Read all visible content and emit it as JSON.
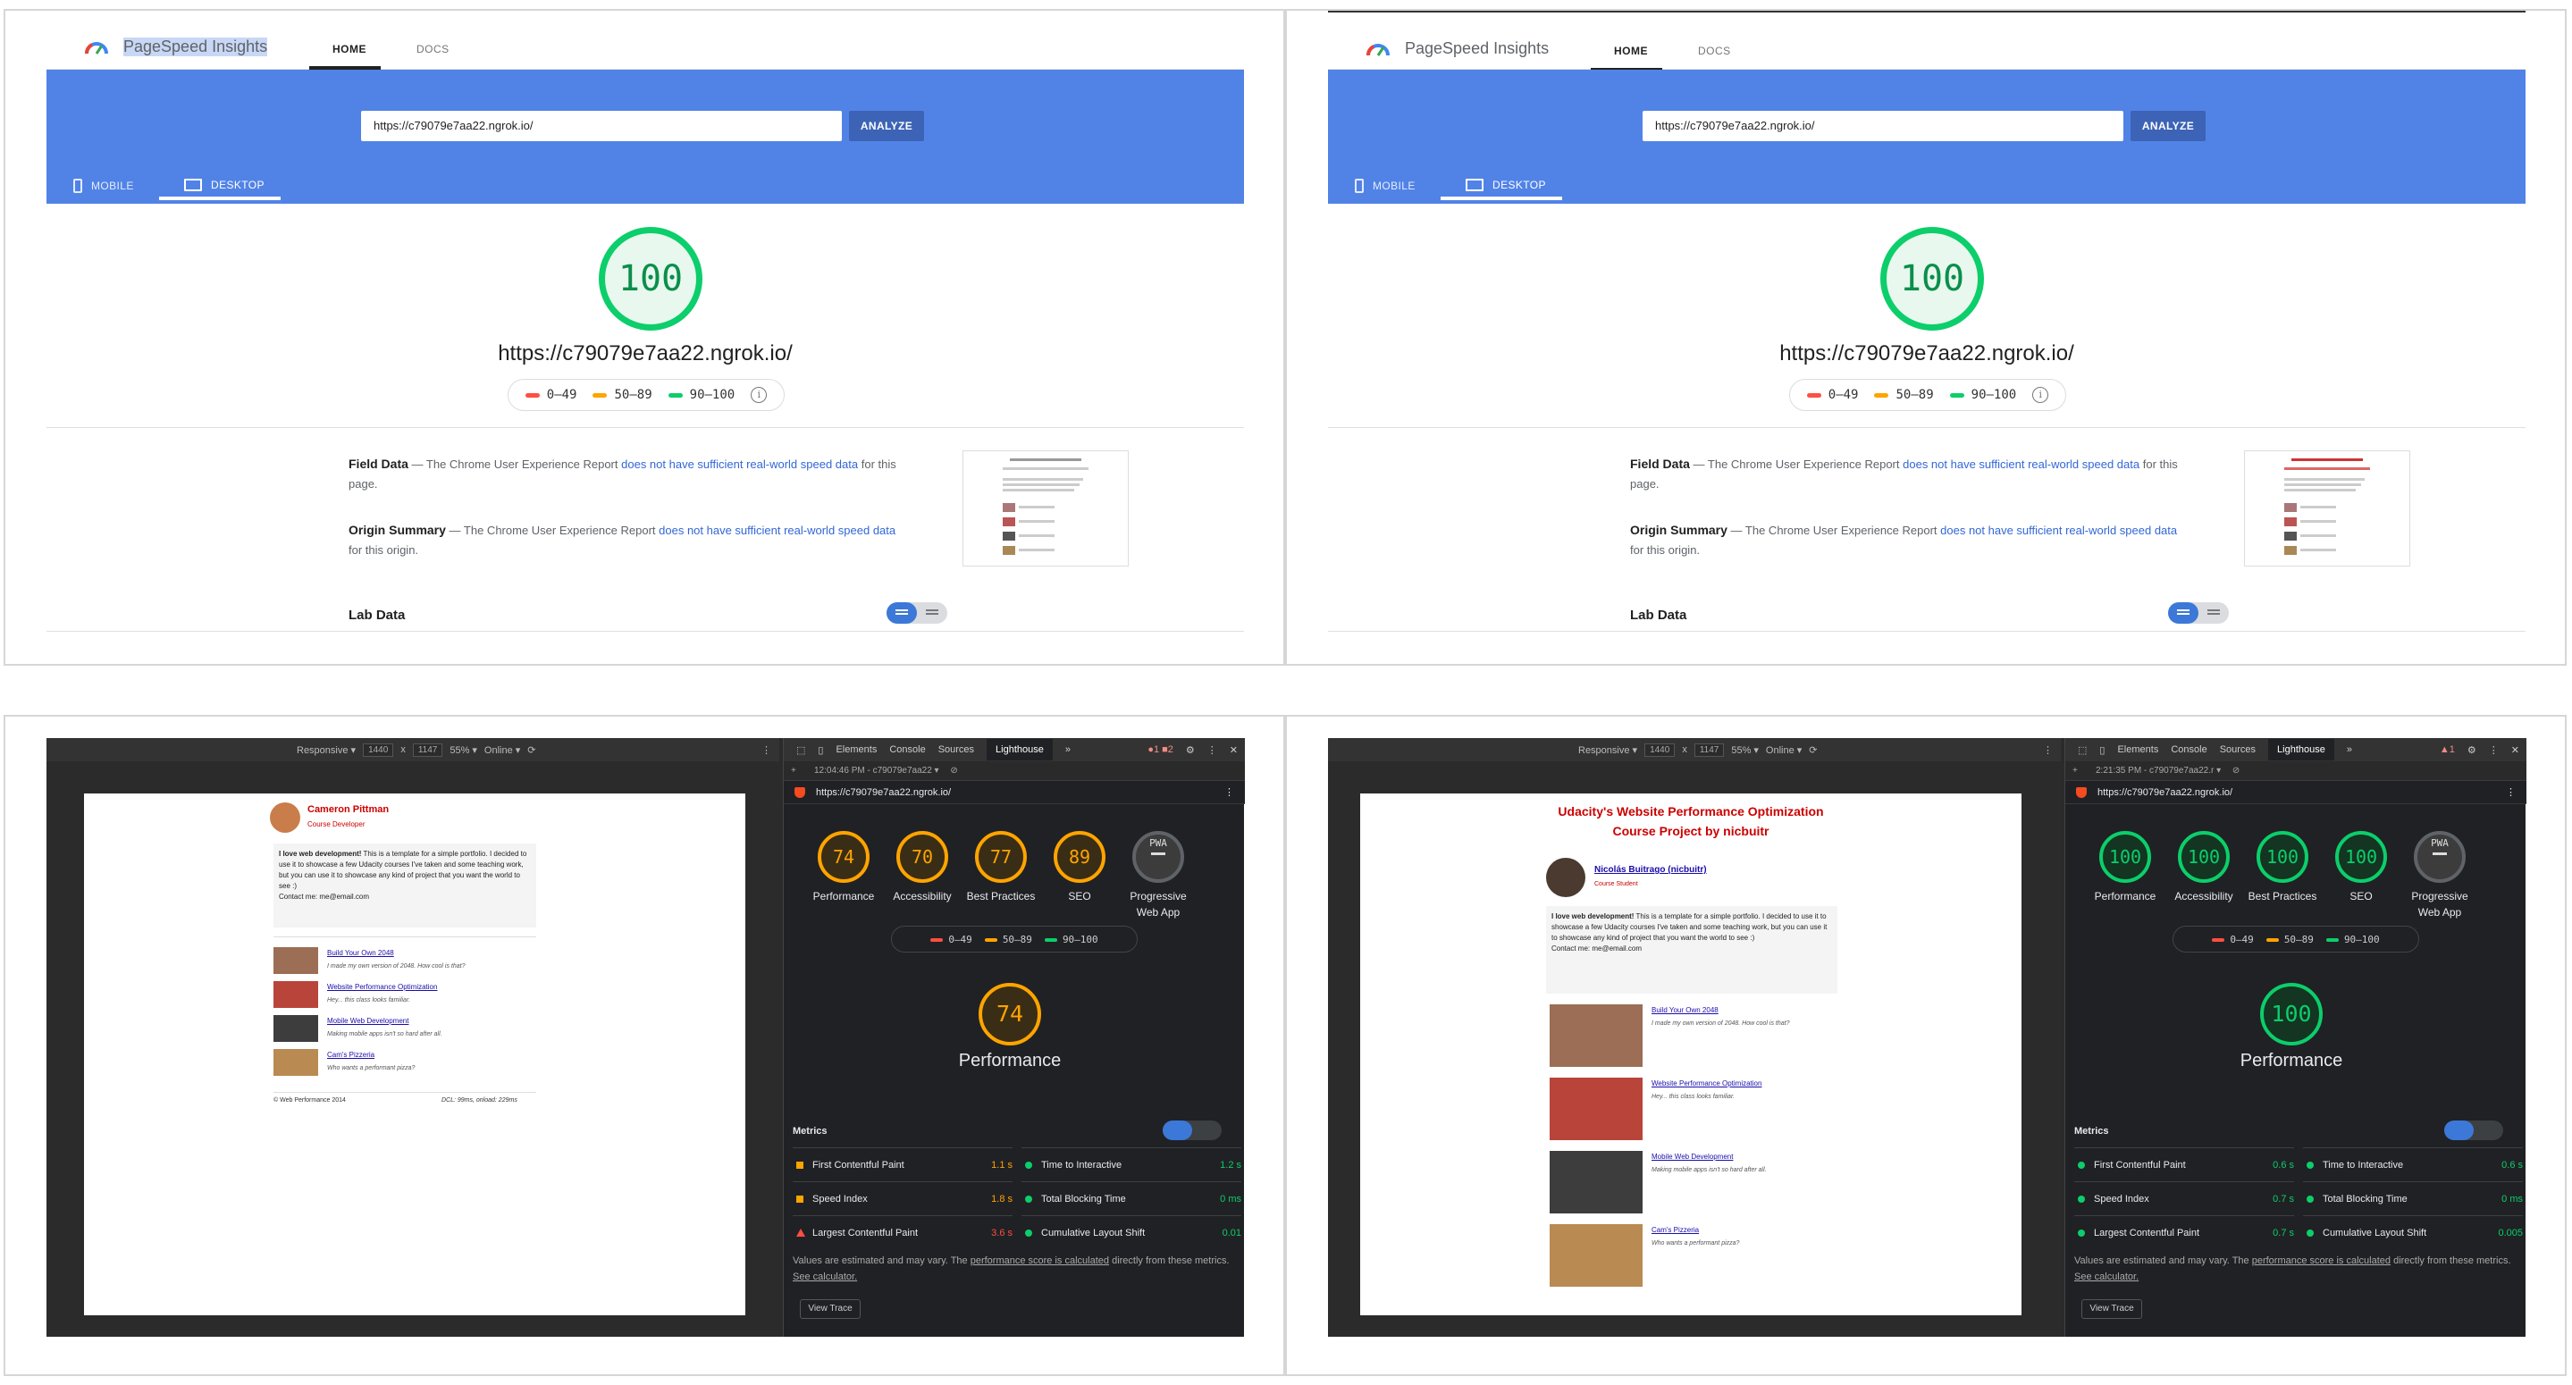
{
  "psi": {
    "app_name": "PageSpeed Insights",
    "tab_home": "HOME",
    "tab_docs": "DOCS",
    "url_input": "https://c79079e7aa22.ngrok.io/",
    "analyze_label": "ANALYZE",
    "mobile_label": "MOBILE",
    "desktop_label": "DESKTOP",
    "score": "100",
    "tested_url": "https://c79079e7aa22.ngrok.io/",
    "legend": [
      "0–49",
      "50–89",
      "90–100"
    ],
    "field_title": "Field Data",
    "field_pre": "— The Chrome User Experience Report",
    "field_link": "does not have sufficient real-world speed data",
    "field_post": "for this page.",
    "origin_title": "Origin Summary",
    "origin_pre": "— The Chrome User Experience Report",
    "origin_link": "does not have sufficient real-world speed data",
    "origin_post": "for this origin.",
    "lab_title": "Lab Data"
  },
  "colors": {
    "pass": "#0cce6b",
    "average": "#ffa400",
    "fail": "#ff4e42",
    "psi_blue": "#5183e7"
  },
  "devtools": {
    "responsive": "Responsive ▾",
    "width": "1440",
    "x": "x",
    "height": "1147",
    "zoom": "55% ▾",
    "online": "Online ▾",
    "tabs": [
      "Elements",
      "Console",
      "Sources",
      "Lighthouse",
      "»"
    ],
    "left": {
      "timestamp": "12:04:46 PM - c79079e7aa22 ▾",
      "badges": "●1  ■2",
      "url": "https://c79079e7aa22.ngrok.io/",
      "categories": [
        {
          "score": "74",
          "label": "Performance"
        },
        {
          "score": "70",
          "label": "Accessibility"
        },
        {
          "score": "77",
          "label": "Best Practices"
        },
        {
          "score": "89",
          "label": "SEO"
        },
        {
          "score": "PWA",
          "label": "Progressive Web App"
        }
      ],
      "perf_score": "74",
      "perf_label": "Performance",
      "metrics_title": "Metrics",
      "metrics": [
        {
          "label": "First Contentful Paint",
          "value": "1.1 s"
        },
        {
          "label": "Speed Index",
          "value": "1.8 s"
        },
        {
          "label": "Largest Contentful Paint",
          "value": "3.6 s"
        },
        {
          "label": "Time to Interactive",
          "value": "1.2 s"
        },
        {
          "label": "Total Blocking Time",
          "value": "0 ms"
        },
        {
          "label": "Cumulative Layout Shift",
          "value": "0.01"
        }
      ],
      "page": {
        "name": "Cameron Pittman",
        "role": "Course Developer",
        "intro_bold": "I love web development!",
        "intro": " This is a template for a simple portfolio. I decided to use it to showcase a few Udacity courses I've taken and some teaching work, but you can use it to showcase any kind of project that you want the world to see :)",
        "contact": "Contact me: me@email.com",
        "items": [
          {
            "title": "Build Your Own 2048",
            "desc": "I made my own version of 2048. How cool is that?"
          },
          {
            "title": "Website Performance Optimization",
            "desc": "Hey... this class looks familiar."
          },
          {
            "title": "Mobile Web Development",
            "desc": "Making mobile apps isn't so hard after all."
          },
          {
            "title": "Cam's Pizzeria",
            "desc": "Who wants a performant pizza?"
          }
        ],
        "footer_left": "© Web Performance 2014",
        "footer_right": "DCL: 99ms, onload: 229ms"
      }
    },
    "right": {
      "timestamp": "2:21:35 PM - c79079e7aa22.r ▾",
      "badges": "▲1",
      "url": "https://c79079e7aa22.ngrok.io/",
      "categories": [
        {
          "score": "100",
          "label": "Performance"
        },
        {
          "score": "100",
          "label": "Accessibility"
        },
        {
          "score": "100",
          "label": "Best Practices"
        },
        {
          "score": "100",
          "label": "SEO"
        },
        {
          "score": "PWA",
          "label": "Progressive Web App"
        }
      ],
      "perf_score": "100",
      "perf_label": "Performance",
      "metrics_title": "Metrics",
      "metrics": [
        {
          "label": "First Contentful Paint",
          "value": "0.6 s"
        },
        {
          "label": "Speed Index",
          "value": "0.7 s"
        },
        {
          "label": "Largest Contentful Paint",
          "value": "0.7 s"
        },
        {
          "label": "Time to Interactive",
          "value": "0.6 s"
        },
        {
          "label": "Total Blocking Time",
          "value": "0 ms"
        },
        {
          "label": "Cumulative Layout Shift",
          "value": "0.005"
        }
      ],
      "page": {
        "heading1": "Udacity's Website Performance Optimization",
        "heading2": "Course Project by nicbuitr",
        "name": "Nicolás Buitrago (nicbuitr)",
        "role": "Course Student",
        "intro_bold": "I love web development!",
        "intro": " This is a template for a simple portfolio. I decided to use it to showcase a few Udacity courses I've taken and some teaching work, but you can use it to showcase any kind of project that you want the world to see :)",
        "contact": "Contact me: me@email.com",
        "items": [
          {
            "title": "Build Your Own 2048",
            "desc": "I made my own version of 2048. How cool is that?"
          },
          {
            "title": "Website Performance Optimization",
            "desc": "Hey... this class looks familiar."
          },
          {
            "title": "Mobile Web Development",
            "desc": "Making mobile apps isn't so hard after all."
          },
          {
            "title": "Cam's Pizzeria",
            "desc": "Who wants a performant pizza?"
          }
        ]
      }
    },
    "note_pre": "Values are estimated and may vary. The",
    "note_link": "performance score is calculated",
    "note_mid": "directly from these metrics.",
    "note_link2": "See calculator.",
    "view_trace": "View Trace"
  }
}
